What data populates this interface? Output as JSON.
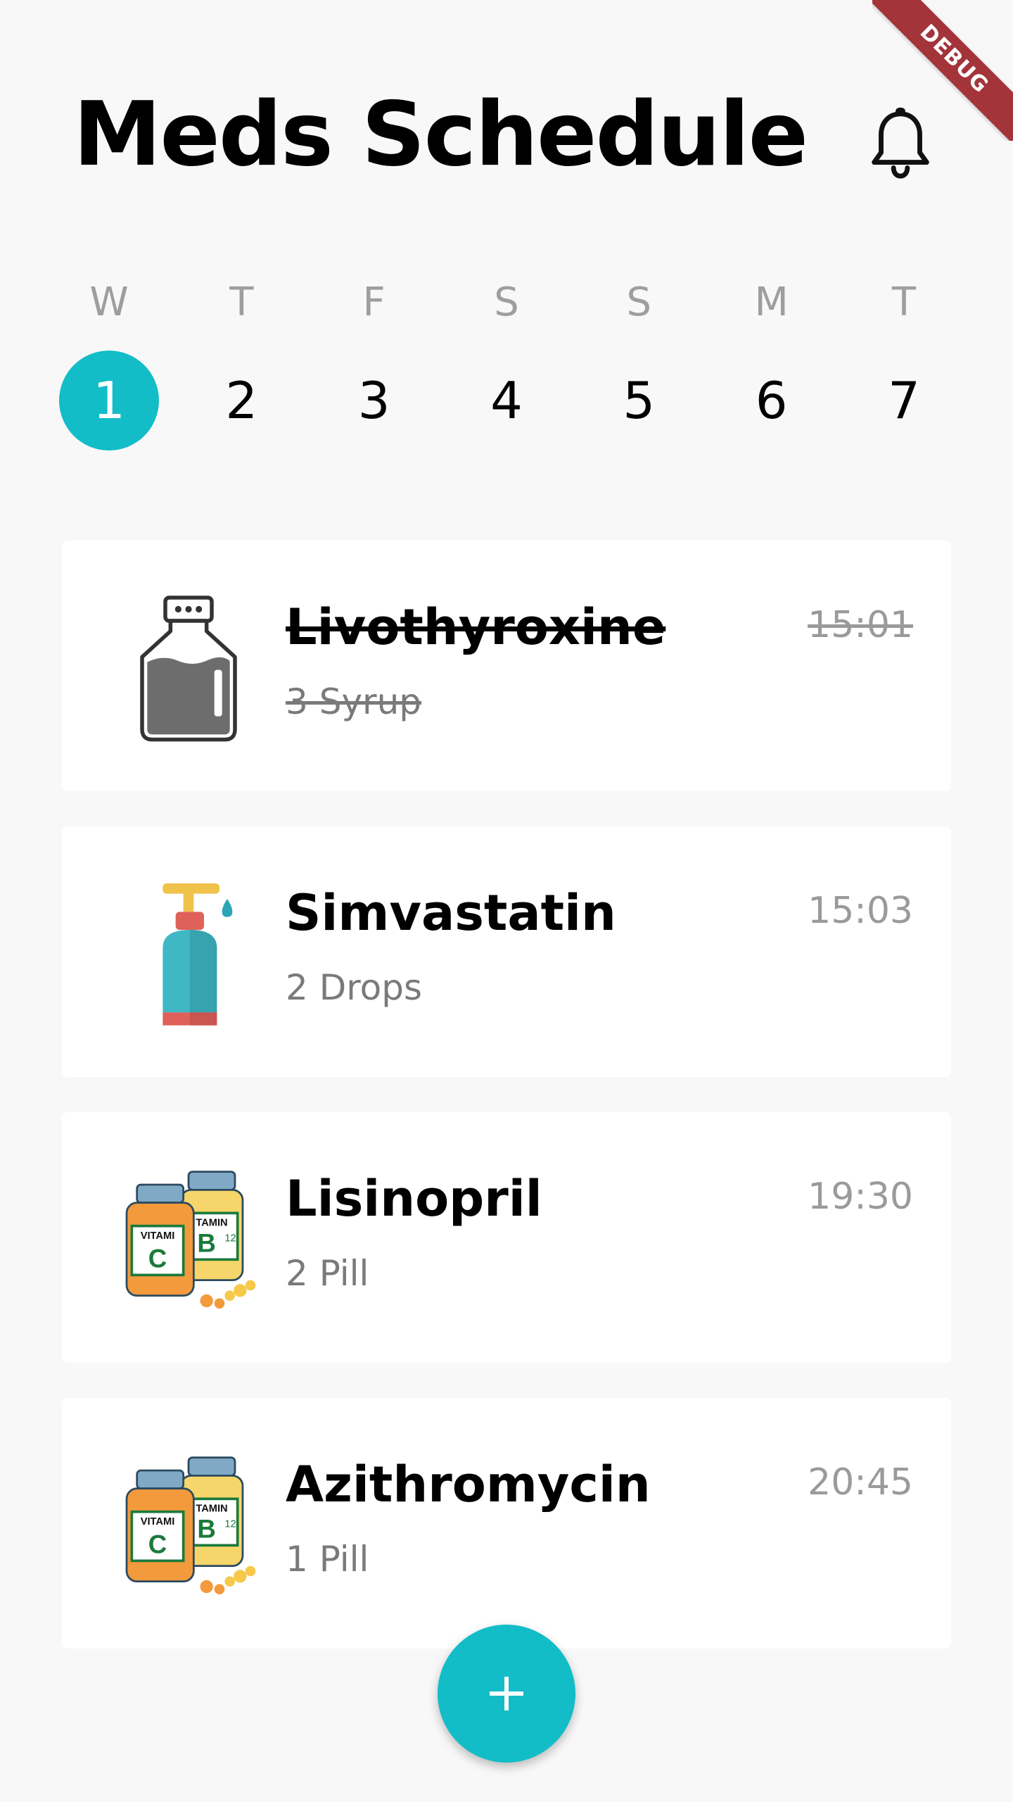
{
  "app": {
    "title": "Meds Schedule",
    "debug_label": "DEBUG",
    "accent_color": "#12bdc8"
  },
  "header": {
    "notification_icon": "bell-icon"
  },
  "calendar": {
    "weekdays": [
      "W",
      "T",
      "F",
      "S",
      "S",
      "M",
      "T"
    ],
    "dates": [
      "1",
      "2",
      "3",
      "4",
      "5",
      "6",
      "7"
    ],
    "selected_date": "1"
  },
  "meds": [
    {
      "name": "Livothyroxine",
      "dose": "3 Syrup",
      "time": "15:01",
      "icon": "syrup-bottle-icon",
      "completed": true
    },
    {
      "name": "Simvastatin",
      "dose": "2 Drops",
      "time": "15:03",
      "icon": "dropper-bottle-icon",
      "completed": false
    },
    {
      "name": "Lisinopril",
      "dose": "2 Pill",
      "time": "19:30",
      "icon": "vitamin-pill-bottles-icon",
      "completed": false
    },
    {
      "name": "Azithromycin",
      "dose": "1 Pill",
      "time": "20:45",
      "icon": "vitamin-pill-bottles-icon",
      "completed": false
    }
  ],
  "fab": {
    "icon": "plus-icon"
  }
}
